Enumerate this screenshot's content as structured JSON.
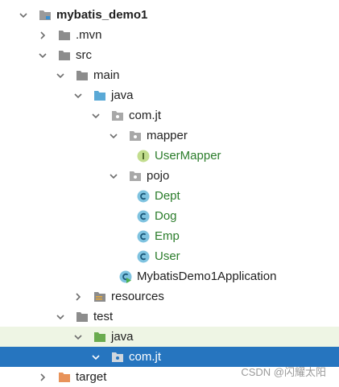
{
  "tree": {
    "rows": [
      {
        "label": "mybatis_demo1",
        "icon": "module-folder-icon",
        "state": "expanded"
      },
      {
        "label": ".mvn",
        "icon": "folder-icon",
        "state": "collapsed"
      },
      {
        "label": "src",
        "icon": "folder-icon",
        "state": "expanded"
      },
      {
        "label": "main",
        "icon": "folder-icon",
        "state": "expanded"
      },
      {
        "label": "java",
        "icon": "source-root-folder-icon",
        "state": "expanded"
      },
      {
        "label": "com.jt",
        "icon": "package-icon",
        "state": "expanded"
      },
      {
        "label": "mapper",
        "icon": "package-icon",
        "state": "expanded"
      },
      {
        "label": "UserMapper",
        "icon": "interface-icon",
        "state": "leaf"
      },
      {
        "label": "pojo",
        "icon": "package-icon",
        "state": "expanded"
      },
      {
        "label": "Dept",
        "icon": "class-icon",
        "state": "leaf"
      },
      {
        "label": "Dog",
        "icon": "class-icon",
        "state": "leaf"
      },
      {
        "label": "Emp",
        "icon": "class-icon",
        "state": "leaf"
      },
      {
        "label": "User",
        "icon": "class-icon",
        "state": "leaf"
      },
      {
        "label": "MybatisDemo1Application",
        "icon": "spring-boot-class-icon",
        "state": "leaf"
      },
      {
        "label": "resources",
        "icon": "resources-folder-icon",
        "state": "collapsed"
      },
      {
        "label": "test",
        "icon": "folder-icon",
        "state": "expanded"
      },
      {
        "label": "java",
        "icon": "test-source-root-folder-icon",
        "state": "expanded"
      },
      {
        "label": "com.jt",
        "icon": "package-icon",
        "state": "expanded"
      },
      {
        "label": "target",
        "icon": "excluded-folder-icon",
        "state": "collapsed"
      }
    ]
  },
  "watermark": "CSDN @闪耀太阳",
  "colors": {
    "selection": "#2675bf",
    "test_row_bg": "#eef5e4",
    "class_text": "#2c7d2c",
    "folder": "#8c8c8c",
    "source_folder": "#5aa9d6",
    "test_folder": "#6aab4f",
    "excluded_folder": "#e8935a"
  }
}
